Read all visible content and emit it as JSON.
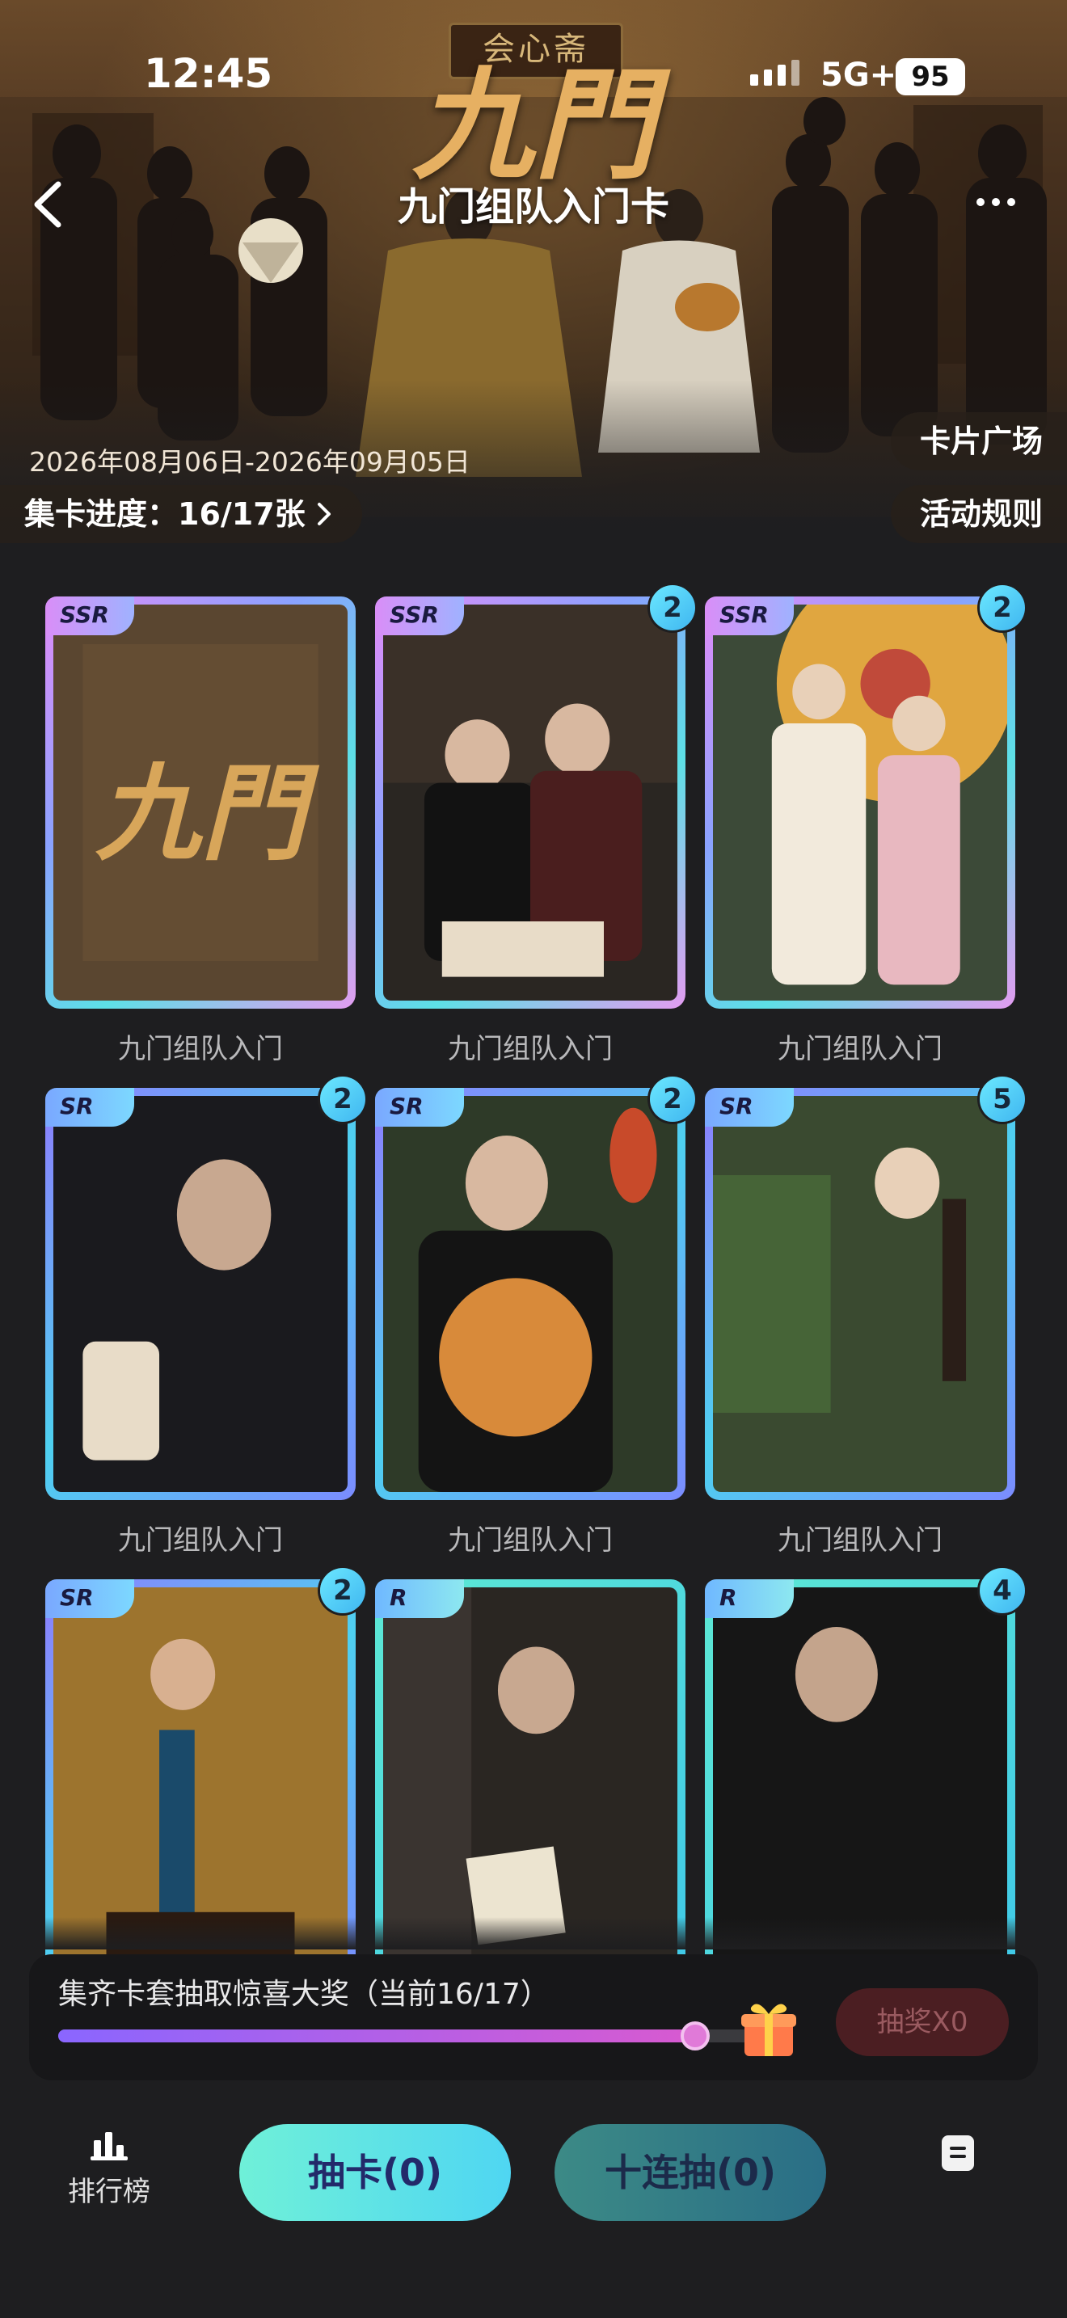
{
  "status_bar": {
    "time": "12:45",
    "network": "5G+",
    "battery": "95"
  },
  "hero": {
    "sign_text": "会心斋",
    "logo_text": "九門",
    "nav_title": "九门组队入门卡",
    "date_range": "2026年08月06日-2026年09月05日",
    "progress_text": "集卡进度：16/17张",
    "card_square_label": "卡片广场",
    "rules_label": "活动规则"
  },
  "cards": [
    {
      "rarity": "SSR",
      "count": "",
      "label": "九门组队入门",
      "theme": "logo"
    },
    {
      "rarity": "SSR",
      "count": "2",
      "label": "九门组队入门",
      "theme": "duo"
    },
    {
      "rarity": "SSR",
      "count": "2",
      "label": "九门组队入门",
      "theme": "umbrella"
    },
    {
      "rarity": "SR",
      "count": "2",
      "label": "九门组队入门",
      "theme": "portrait"
    },
    {
      "rarity": "SR",
      "count": "2",
      "label": "九门组队入门",
      "theme": "dog"
    },
    {
      "rarity": "SR",
      "count": "5",
      "label": "九门组队入门",
      "theme": "qipao"
    },
    {
      "rarity": "SR",
      "count": "2",
      "label": "",
      "theme": "seated"
    },
    {
      "rarity": "R",
      "count": "",
      "label": "",
      "theme": "letter"
    },
    {
      "rarity": "R",
      "count": "4",
      "label": "",
      "theme": "dark"
    }
  ],
  "reward": {
    "text": "集齐卡套抽取惊喜大奖（当前16/17）",
    "progress": 0.9412,
    "lottery_label": "抽奖X0"
  },
  "bottom": {
    "rank_label": "排行榜",
    "draw_label": "抽卡(0)",
    "draw10_label": "十连抽(0)"
  },
  "colors": {
    "background": "#1e1e20",
    "ssr_frame": "#e38bf7",
    "sr_frame": "#8f7bff",
    "r_frame": "#5de8d4",
    "draw_button": "#6ff0d8",
    "lottery_disabled": "#4b1e22"
  },
  "icons": {
    "back": "chevron-left-icon",
    "more": "more-dots-icon",
    "progress_arrow": "chevron-right-icon",
    "gift": "gift-box-icon",
    "rank": "bar-chart-icon",
    "doc": "document-icon"
  }
}
